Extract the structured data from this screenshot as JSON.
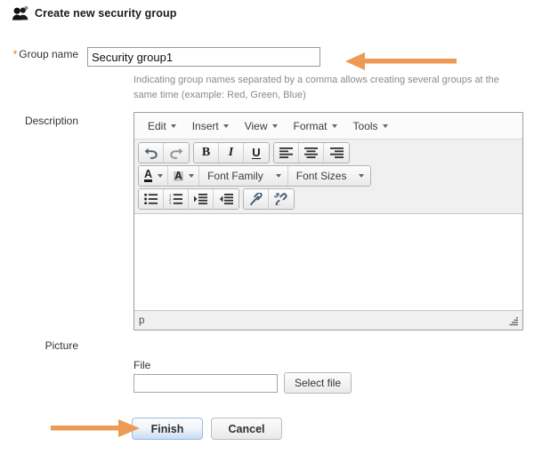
{
  "header": {
    "icon": "users-group-icon",
    "title": "Create new security group"
  },
  "form": {
    "group_name": {
      "required_marker": "*",
      "label": "Group name",
      "value": "Security group1",
      "placeholder": "",
      "hint": "Indicating group names separated by a comma allows creating several groups at the same time (example: Red, Green, Blue)"
    },
    "description": {
      "label": "Description",
      "editor": {
        "menubar": [
          {
            "label": "Edit",
            "icon": "chevron-down-icon"
          },
          {
            "label": "Insert",
            "icon": "chevron-down-icon"
          },
          {
            "label": "View",
            "icon": "chevron-down-icon"
          },
          {
            "label": "Format",
            "icon": "chevron-down-icon"
          },
          {
            "label": "Tools",
            "icon": "chevron-down-icon"
          }
        ],
        "toolbar_row1": [
          {
            "icon": "undo-icon",
            "label": "Undo"
          },
          {
            "icon": "redo-icon",
            "label": "Redo"
          },
          {
            "icon": "bold-icon",
            "label": "B"
          },
          {
            "icon": "italic-icon",
            "label": "I"
          },
          {
            "icon": "underline-icon",
            "label": "U"
          },
          {
            "icon": "align-left-icon",
            "label": "Align left"
          },
          {
            "icon": "align-center-icon",
            "label": "Align center"
          },
          {
            "icon": "align-right-icon",
            "label": "Align right"
          }
        ],
        "toolbar_row2": [
          {
            "icon": "text-color-icon",
            "label": "A"
          },
          {
            "icon": "background-color-icon",
            "label": "A"
          },
          {
            "icon": "font-family-select",
            "label": "Font Family"
          },
          {
            "icon": "font-sizes-select",
            "label": "Font Sizes"
          }
        ],
        "toolbar_row3": [
          {
            "icon": "bullet-list-icon",
            "label": "Bullet list"
          },
          {
            "icon": "numbered-list-icon",
            "label": "Numbered list"
          },
          {
            "icon": "indent-icon",
            "label": "Increase indent"
          },
          {
            "icon": "outdent-icon",
            "label": "Decrease indent"
          },
          {
            "icon": "link-icon",
            "label": "Insert link"
          },
          {
            "icon": "unlink-icon",
            "label": "Remove link"
          }
        ],
        "content": "",
        "statusbar_path": "p",
        "resize_grip_icon": "resize-grip-icon"
      }
    },
    "picture": {
      "label": "Picture",
      "file_label": "File",
      "file_value": "",
      "select_file_label": "Select file"
    }
  },
  "actions": {
    "finish_label": "Finish",
    "cancel_label": "Cancel"
  },
  "annotations": [
    {
      "name": "arrow-pointing-to-group-name-input",
      "icon": "left-arrow-annotation",
      "color": "#EC9A54"
    },
    {
      "name": "arrow-pointing-to-finish-button",
      "icon": "right-arrow-annotation",
      "color": "#EC9A54"
    }
  ],
  "colors": {
    "accent_orange": "#EC9A54",
    "required_star": "#E07B12",
    "finish_button_blue": "#C8DCF2",
    "hint_text": "#8A8A8A"
  }
}
